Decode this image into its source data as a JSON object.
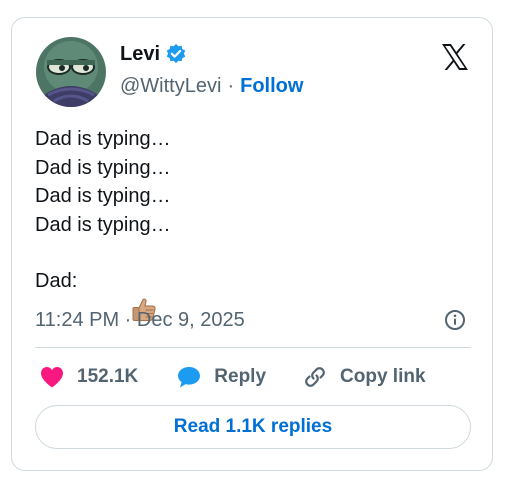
{
  "author": {
    "display_name": "Levi",
    "handle": "@WittyLevi",
    "separator": "·",
    "follow_label": "Follow"
  },
  "tweet": {
    "lines": [
      "Dad is typing…",
      "Dad is typing…",
      "Dad is typing…",
      "Dad is typing…"
    ],
    "final_line": "Dad:",
    "final_emoji": "thumbs-up-icon",
    "timestamp": "11:24 PM · Dec 9, 2025"
  },
  "actions": {
    "like_count": "152.1K",
    "reply_label": "Reply",
    "copy_link_label": "Copy link"
  },
  "read_replies_label": "Read 1.1K replies",
  "colors": {
    "accent": "#006fd6",
    "like": "#f91880",
    "reply": "#1d9bf0",
    "muted": "#536471",
    "border": "#cfd9de"
  }
}
